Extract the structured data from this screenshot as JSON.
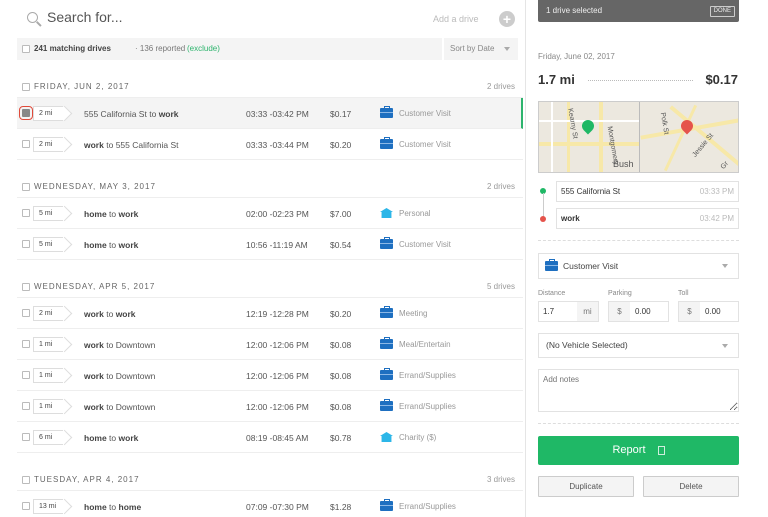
{
  "search": {
    "placeholder": "Search for...",
    "add_label": "Add a drive",
    "add_icon": "+"
  },
  "filter": {
    "count": "241 matching drives",
    "meta": "· 136 reported",
    "exclude": "(exclude)",
    "sort": "Sort by Date"
  },
  "groups": [
    {
      "date": "FRIDAY, JUN 2, 2017",
      "count": "2 drives",
      "rows": [
        {
          "miles": "2 mi",
          "from": "555 California St",
          "from_bold": false,
          "sep": "to",
          "to": "work",
          "to_bold": true,
          "time": "03:33 -03:42 PM",
          "cost": "$0.17",
          "icon": "briefcase",
          "category": "Customer Visit",
          "selected": true
        },
        {
          "miles": "2 mi",
          "from": "work",
          "from_bold": true,
          "sep": "to",
          "to": "555 California St",
          "to_bold": false,
          "time": "03:33 -03:44 PM",
          "cost": "$0.20",
          "icon": "briefcase",
          "category": "Customer Visit"
        }
      ]
    },
    {
      "date": "WEDNESDAY, MAY 3, 2017",
      "count": "2 drives",
      "rows": [
        {
          "miles": "5 mi",
          "from": "home",
          "from_bold": true,
          "sep": "to",
          "to": "work",
          "to_bold": true,
          "time": "02:00 -02:23 PM",
          "cost": "$7.00",
          "icon": "home",
          "category": "Personal"
        },
        {
          "miles": "5 mi",
          "from": "home",
          "from_bold": true,
          "sep": "to",
          "to": "work",
          "to_bold": true,
          "time": "10:56 -11:19 AM",
          "cost": "$0.54",
          "icon": "briefcase",
          "category": "Customer Visit"
        }
      ]
    },
    {
      "date": "WEDNESDAY, APR 5, 2017",
      "count": "5 drives",
      "rows": [
        {
          "miles": "2 mi",
          "from": "work",
          "from_bold": true,
          "sep": "to",
          "to": "work",
          "to_bold": true,
          "time": "12:19 -12:28 PM",
          "cost": "$0.20",
          "icon": "briefcase",
          "category": "Meeting"
        },
        {
          "miles": "1 mi",
          "from": "work",
          "from_bold": true,
          "sep": "to",
          "to": "Downtown",
          "to_bold": false,
          "time": "12:00 -12:06 PM",
          "cost": "$0.08",
          "icon": "briefcase",
          "category": "Meal/Entertain"
        },
        {
          "miles": "1 mi",
          "from": "work",
          "from_bold": true,
          "sep": "to",
          "to": "Downtown",
          "to_bold": false,
          "time": "12:00 -12:06 PM",
          "cost": "$0.08",
          "icon": "briefcase",
          "category": "Errand/Supplies"
        },
        {
          "miles": "1 mi",
          "from": "work",
          "from_bold": true,
          "sep": "to",
          "to": "Downtown",
          "to_bold": false,
          "time": "12:00 -12:06 PM",
          "cost": "$0.08",
          "icon": "briefcase",
          "category": "Errand/Supplies"
        },
        {
          "miles": "6 mi",
          "from": "home",
          "from_bold": true,
          "sep": "to",
          "to": "work",
          "to_bold": true,
          "time": "08:19 -08:45 AM",
          "cost": "$0.78",
          "icon": "home",
          "category": "Charity ($)"
        }
      ]
    },
    {
      "date": "TUESDAY, APR 4, 2017",
      "count": "3 drives",
      "rows": [
        {
          "miles": "13 mi",
          "from": "home",
          "from_bold": true,
          "sep": "to",
          "to": "home",
          "to_bold": true,
          "time": "07:09 -07:30 PM",
          "cost": "$1.28",
          "icon": "briefcase",
          "category": "Errand/Supplies"
        }
      ]
    }
  ],
  "detail": {
    "selection": "1 drive selected",
    "done": "DONE",
    "date": "Friday, June 02, 2017",
    "distance": "1.7 mi",
    "amount": "$0.17",
    "map_labels": [
      "Kearny St",
      "Montgomery",
      "Bush",
      "Polk St",
      "Jessie St",
      "Gr"
    ],
    "start": {
      "place": "555 California St",
      "time": "03:33 PM"
    },
    "end": {
      "place": "work",
      "time": "03:42 PM"
    },
    "category": "Customer Visit",
    "distance_label": "Distance",
    "distance_value": "1.7",
    "distance_unit": "mi",
    "parking_label": "Parking",
    "parking_currency": "$",
    "parking_value": "0.00",
    "toll_label": "Toll",
    "toll_currency": "$",
    "toll_value": "0.00",
    "vehicle": "(No Vehicle Selected)",
    "notes_placeholder": "Add notes",
    "report": "Report",
    "duplicate": "Duplicate",
    "delete": "Delete"
  },
  "colors": {
    "accent": "#1fb866",
    "business": "#1e6fc0",
    "personal": "#2cb6e8",
    "start_pin": "#1fb866",
    "end_pin": "#e5534b"
  }
}
